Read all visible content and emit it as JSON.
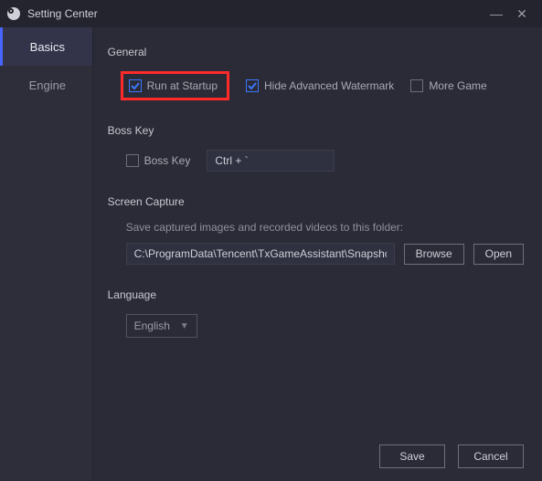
{
  "titlebar": {
    "title": "Setting Center"
  },
  "sidebar": {
    "items": [
      {
        "label": "Basics",
        "active": true
      },
      {
        "label": "Engine",
        "active": false
      }
    ]
  },
  "general": {
    "title": "General",
    "run_at_startup": {
      "label": "Run at Startup",
      "checked": true
    },
    "hide_watermark": {
      "label": "Hide Advanced Watermark",
      "checked": true
    },
    "more_game": {
      "label": "More Game",
      "checked": false
    }
  },
  "boss_key": {
    "title": "Boss Key",
    "checkbox": {
      "label": "Boss Key",
      "checked": false
    },
    "hotkey_value": "Ctrl + `"
  },
  "screen_capture": {
    "title": "Screen Capture",
    "helper": "Save captured images and recorded videos to this folder:",
    "path": "C:\\ProgramData\\Tencent\\TxGameAssistant\\Snapshot",
    "browse": "Browse",
    "open": "Open"
  },
  "language": {
    "title": "Language",
    "selected": "English"
  },
  "footer": {
    "save": "Save",
    "cancel": "Cancel"
  }
}
